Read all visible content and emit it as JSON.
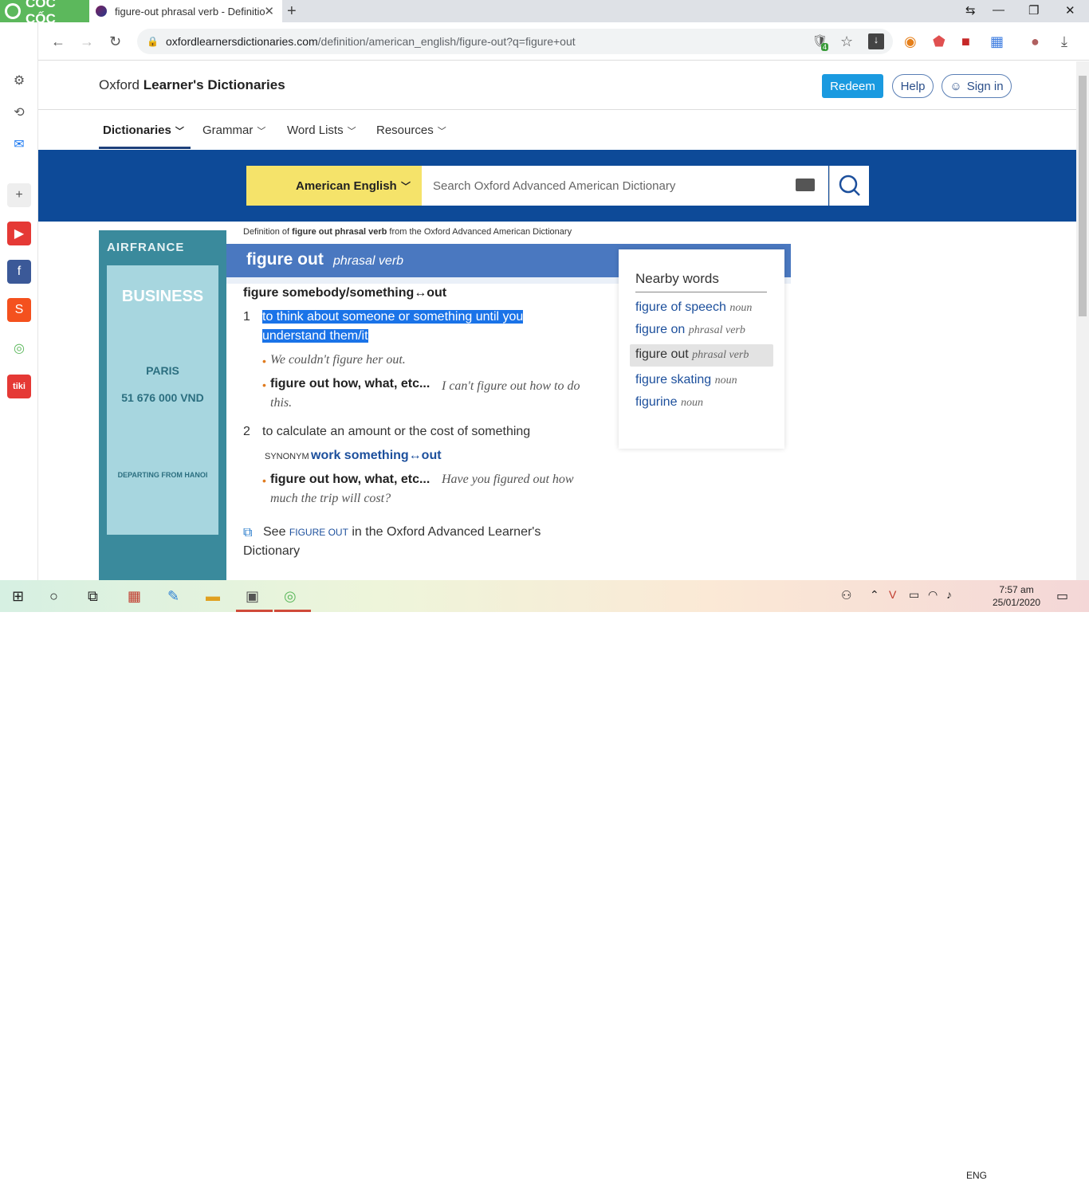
{
  "browser": {
    "brand": "CỐC CỐC",
    "tab_title": "figure-out phrasal verb - Definitio",
    "tab_close": "✕",
    "new_tab": "+",
    "url_host": "oxfordlearnersdictionaries.com",
    "url_path": "/definition/american_english/figure-out?q=figure+out",
    "extension_badge": "4"
  },
  "site": {
    "logo_prefix": "Oxford ",
    "logo_bold": "Learner's Dictionaries",
    "redeem": "Redeem",
    "help": "Help",
    "signin": "Sign in",
    "nav": [
      "Dictionaries",
      "Grammar",
      "Word Lists",
      "Resources"
    ],
    "dict_select": "American English",
    "search_placeholder": "Search Oxford Advanced American Dictionary"
  },
  "ad": {
    "brand": "AIRFRANCE",
    "class": "BUSINESS",
    "city": "PARIS",
    "price": "51 676 000 VND",
    "departing": "DEPARTING FROM HANOI"
  },
  "entry": {
    "definition_of_prefix": "Definition of ",
    "definition_of_word": "figure out phrasal verb",
    "definition_of_suffix": " from the Oxford Advanced American Dictionary",
    "headword": "figure out",
    "pos": "phrasal verb",
    "pattern": "figure somebody/something↔out",
    "sense1_num": "1",
    "sense1_line1": "to think about someone or something until you",
    "sense1_line2": "understand them/it",
    "ex1": "We couldn't figure her out.",
    "ex2_pattern": "figure out how, what, etc...",
    "ex2_line1": "I can't figure out how to do",
    "ex2_line2": "this.",
    "sense2_num": "2",
    "sense2_def": "to calculate an amount or the cost of something",
    "synonym_label": "SYNONYM",
    "synonym_word": "work something↔out",
    "ex3_pattern": "figure out how, what, etc...",
    "ex3_line1": "Have you figured out how",
    "ex3_line2": "much the trip will cost?",
    "see_prefix": "See ",
    "see_link": "FIGURE OUT",
    "see_suffix": " in the Oxford Advanced Learner's",
    "see_line2": "Dictionary"
  },
  "nearby": {
    "title": "Nearby words",
    "items": [
      {
        "word": "figure of speech",
        "pos": "noun"
      },
      {
        "word": "figure on",
        "pos": "phrasal verb"
      },
      {
        "word": "figure out",
        "pos": "phrasal verb"
      },
      {
        "word": "figure skating",
        "pos": "noun"
      },
      {
        "word": "figurine",
        "pos": "noun"
      }
    ]
  },
  "taskbar": {
    "lang": "ENG",
    "time": "7:57 am",
    "date": "25/01/2020"
  },
  "colors": {
    "accent_blue": "#0d4a98",
    "header_band": "#4a78c0",
    "dict_yellow": "#f5e36a",
    "redeem_blue": "#1a9ae0",
    "selection": "#1a73e8"
  }
}
